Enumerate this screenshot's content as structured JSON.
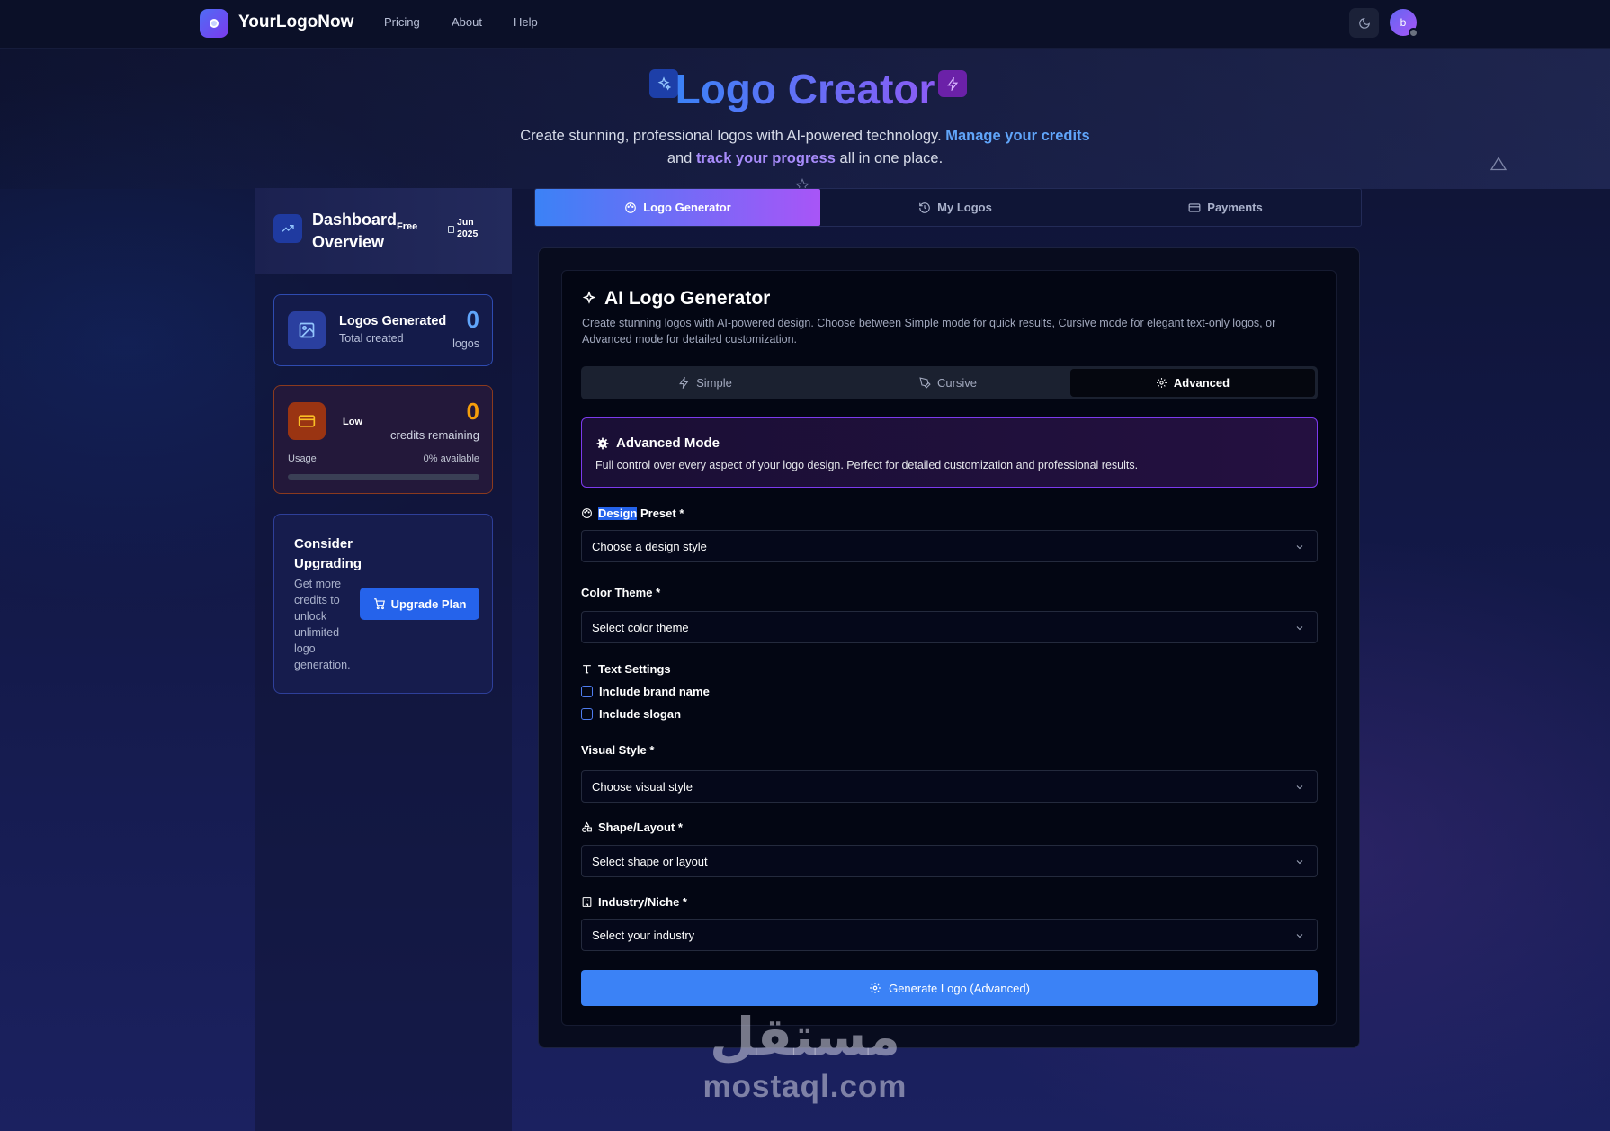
{
  "nav": {
    "brand": "YourLogoNow",
    "links": [
      "Pricing",
      "About",
      "Help"
    ],
    "avatar_initial": "b"
  },
  "hero": {
    "title": "Logo Creator",
    "subtitle_part1": "Create stunning, professional logos with AI-powered technology.",
    "subtitle_link1": "Manage your credits",
    "subtitle_part2": "and",
    "subtitle_link2": "track your progress",
    "subtitle_part3": "all in one place."
  },
  "sidebar": {
    "title": "Dashboard Overview",
    "plan_badge": "Free",
    "date_badge": "Jun 2025",
    "logos_card": {
      "title": "Logos Generated",
      "subtitle": "Total created",
      "count": "0",
      "unit": "logos"
    },
    "credits_card": {
      "badge": "Low",
      "count": "0",
      "label": "credits remaining",
      "usage_label": "Usage",
      "usage_value": "0% available",
      "usage_fraction": 0
    },
    "upgrade_card": {
      "title": "Consider Upgrading",
      "text": "Get more credits to unlock unlimited logo generation.",
      "button": "Upgrade Plan"
    }
  },
  "tabs": [
    "Logo Generator",
    "My Logos",
    "Payments"
  ],
  "generator": {
    "title": "AI Logo Generator",
    "description": "Create stunning logos with AI-powered design. Choose between Simple mode for quick results, Cursive mode for elegant text-only logos, or Advanced mode for detailed customization.",
    "modes": [
      "Simple",
      "Cursive",
      "Advanced"
    ],
    "active_mode": "Advanced",
    "advanced_box": {
      "title": "Advanced Mode",
      "text": "Full control over every aspect of your logo design. Perfect for detailed customization and professional results."
    },
    "fields": {
      "design_preset": {
        "label_highlight": "Design",
        "label_rest": "Preset *",
        "placeholder": "Choose a design style"
      },
      "color_theme": {
        "label": "Color Theme *",
        "placeholder": "Select color theme"
      },
      "text_settings": {
        "label": "Text Settings",
        "options": [
          "Include brand name",
          "Include slogan"
        ]
      },
      "visual_style": {
        "label": "Visual Style *",
        "placeholder": "Choose visual style"
      },
      "shape_layout": {
        "label": "Shape/Layout *",
        "placeholder": "Select shape or layout"
      },
      "industry": {
        "label": "Industry/Niche *",
        "placeholder": "Select your industry"
      }
    },
    "generate_button": "Generate Logo (Advanced)"
  },
  "watermark": {
    "arabic": "مستقل",
    "latin": "mostaql.com"
  },
  "colors": {
    "accent_blue": "#3b82f6",
    "accent_purple": "#8b5cf6",
    "credits_orange": "#f59e0b"
  }
}
